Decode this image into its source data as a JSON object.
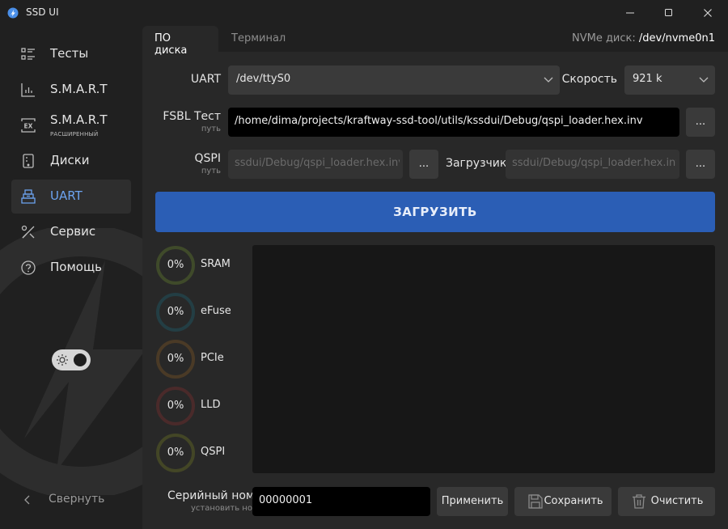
{
  "window": {
    "title": "SSD UI"
  },
  "sidebar": {
    "items": [
      {
        "label": "Тесты",
        "icon": "tests-list-icon"
      },
      {
        "label": "S.M.A.R.T",
        "icon": "chart-icon"
      },
      {
        "label": "S.M.A.R.T",
        "sublabel": "РАСШИРЕННЫЙ",
        "icon": "ex-icon"
      },
      {
        "label": "Диски",
        "icon": "disk-icon"
      },
      {
        "label": "UART",
        "icon": "uart-icon",
        "active": true
      },
      {
        "label": "Сервис",
        "icon": "tools-icon"
      },
      {
        "label": "Помощь",
        "icon": "help-icon"
      }
    ],
    "collapse_label": "Свернуть",
    "theme_toggle": {
      "state": "dark"
    }
  },
  "tabs": [
    {
      "label": "ПО диска",
      "active": true
    },
    {
      "label": "Терминал",
      "active": false
    }
  ],
  "nvme": {
    "label": "NVMe диск:",
    "value": "/dev/nvme0n1"
  },
  "form": {
    "uart_label": "UART",
    "uart_value": "/dev/ttyS0",
    "speed_label": "Скорость",
    "speed_value": "921 k",
    "fsbl_label": "FSBL Тест",
    "fsbl_sublabel": "путь",
    "fsbl_value": "/home/dima/projects/kraftway-ssd-tool/utils/kssdui/Debug/qspi_loader.hex.inv",
    "browse_label": "...",
    "qspi_label": "QSPI",
    "qspi_sublabel": "путь",
    "qspi_value": "ssdui/Debug/qspi_loader.hex.inv",
    "loader_label": "Загрузчик",
    "loader_value": "ssdui/Debug/qspi_loader.hex.inv"
  },
  "upload_button": "ЗАГРУЗИТЬ",
  "progress": [
    {
      "label": "SRAM",
      "percent": "0%",
      "value": 0,
      "color": "#3f4a2a"
    },
    {
      "label": "eFuse",
      "percent": "0%",
      "value": 0,
      "color": "#233e44"
    },
    {
      "label": "PCIe",
      "percent": "0%",
      "value": 0,
      "color": "#4a3a26"
    },
    {
      "label": "LLD",
      "percent": "0%",
      "value": 0,
      "color": "#4a2a2a"
    },
    {
      "label": "QSPI",
      "percent": "0%",
      "value": 0,
      "color": "#434626"
    }
  ],
  "serial": {
    "label": "Серийный номер",
    "sublabel": "установить номер",
    "value": "00000001",
    "apply_label": "Применить",
    "save_label": "Сохранить",
    "clear_label": "Очистить"
  },
  "colors": {
    "accent": "#2b5eb5",
    "active_text": "#6ca3f0"
  }
}
